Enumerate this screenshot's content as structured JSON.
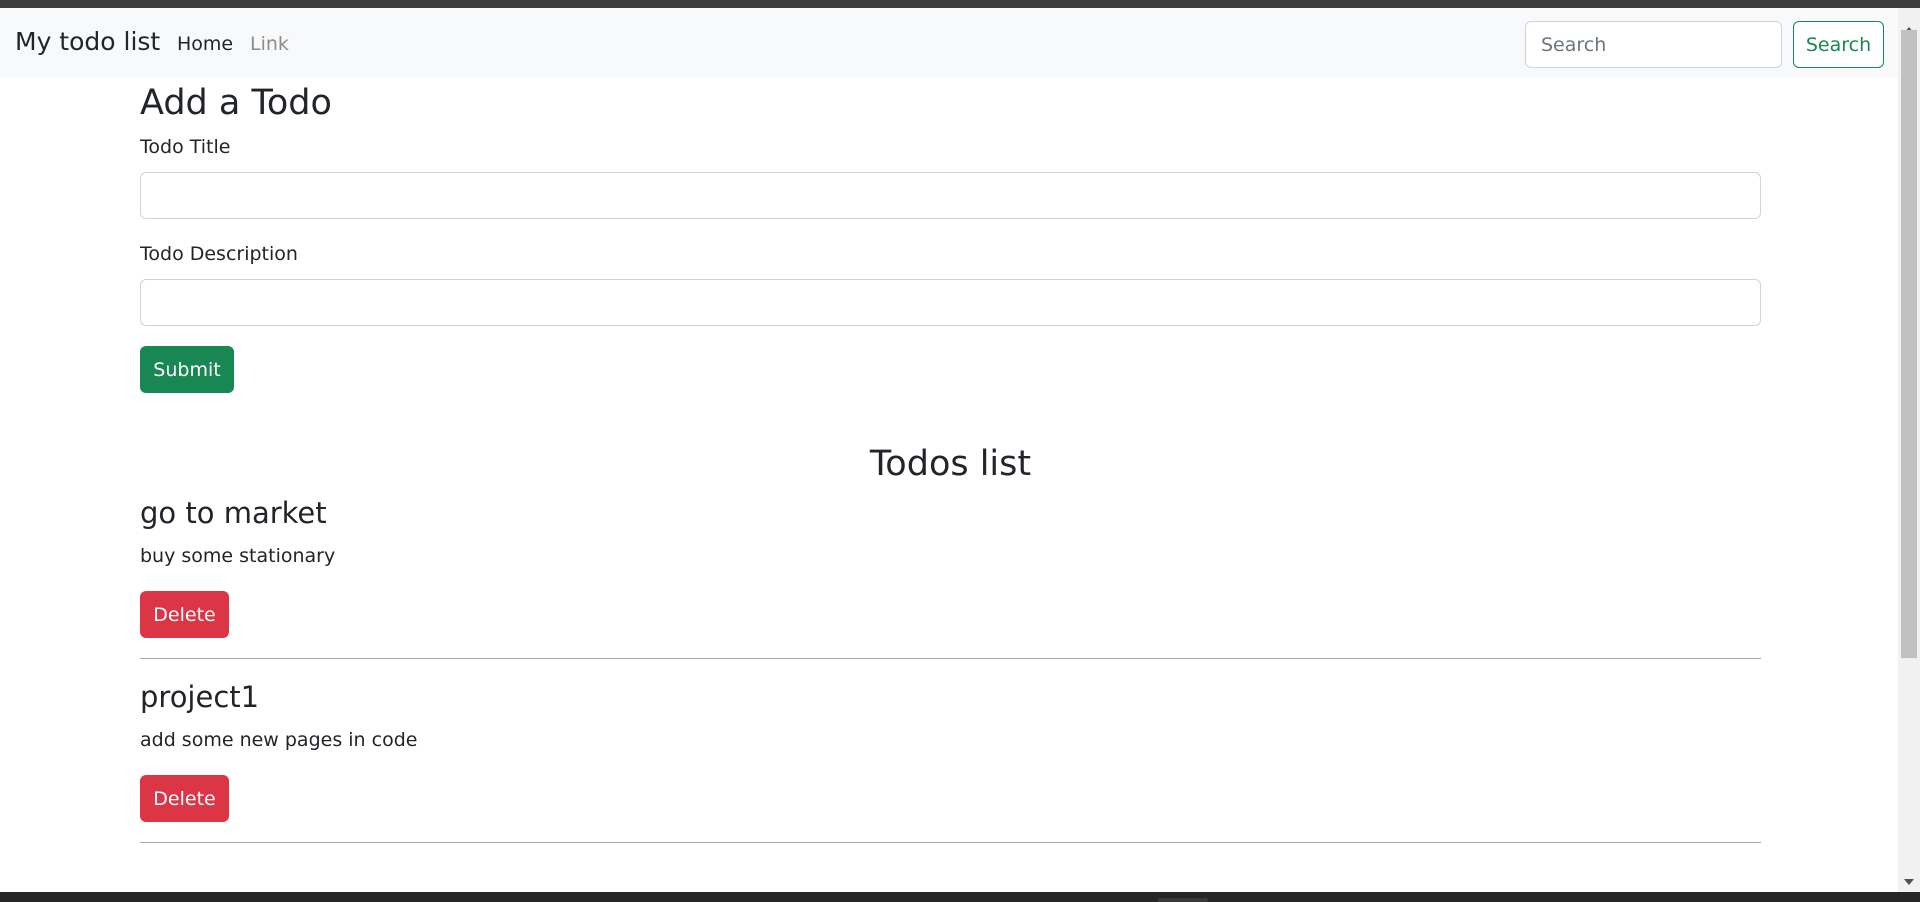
{
  "navbar": {
    "brand": "My todo list",
    "items": [
      {
        "label": "Home"
      },
      {
        "label": "Link"
      }
    ],
    "search": {
      "placeholder": "Search",
      "value": "",
      "button_label": "Search"
    }
  },
  "form": {
    "heading": "Add a Todo",
    "title_label": "Todo Title",
    "title_value": "",
    "description_label": "Todo Description",
    "description_value": "",
    "submit_label": "Submit"
  },
  "list": {
    "heading": "Todos list",
    "todos": [
      {
        "title": "go to market",
        "description": "buy some stationary",
        "delete_label": "Delete"
      },
      {
        "title": "project1",
        "description": "add some new pages in code",
        "delete_label": "Delete"
      }
    ]
  },
  "colors": {
    "success": "#198754",
    "danger": "#dc3545",
    "navbar_bg": "#f8f9fa",
    "muted_link": "#8c8c8c"
  },
  "icons": [
    "scroll-up-arrow-icon",
    "scroll-down-arrow-icon"
  ]
}
